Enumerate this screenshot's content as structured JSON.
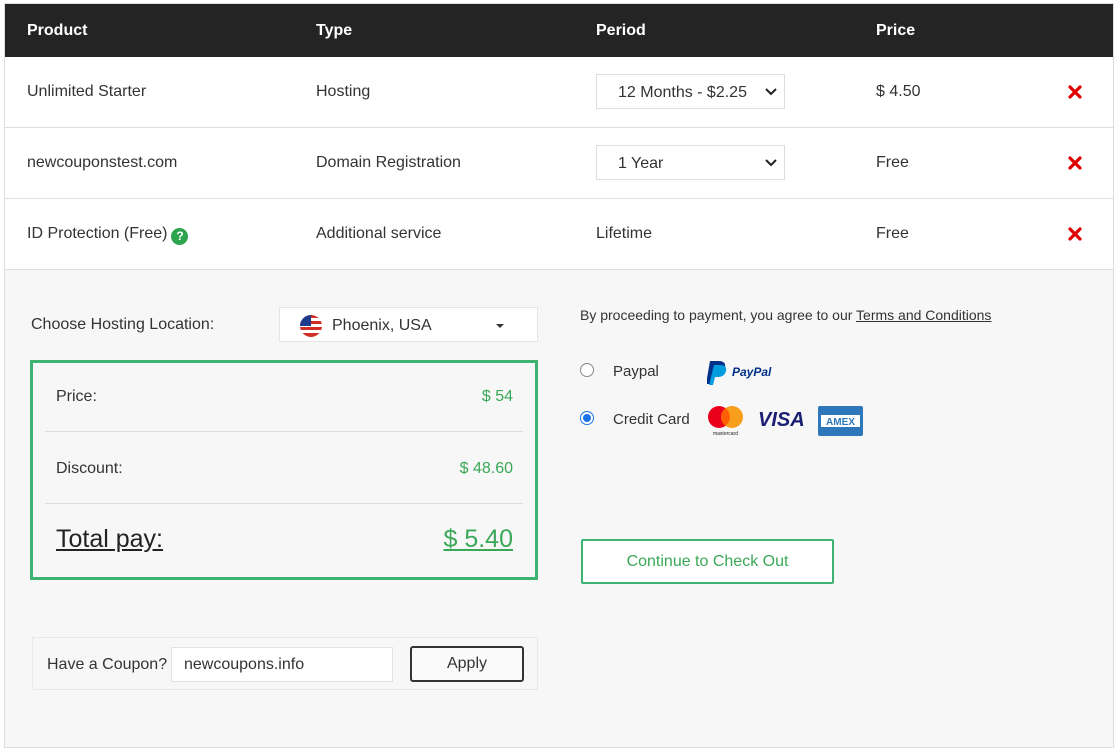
{
  "table": {
    "headers": {
      "product": "Product",
      "type": "Type",
      "period": "Period",
      "price": "Price"
    },
    "rows": [
      {
        "product": "Unlimited Starter",
        "type": "Hosting",
        "period": "12 Months - $2.25",
        "period_is_select": true,
        "price": "$ 4.50"
      },
      {
        "product": "newcouponstest.com",
        "type": "Domain Registration",
        "period": "1 Year",
        "period_is_select": true,
        "price": "Free"
      },
      {
        "product": "ID Protection (Free)",
        "help_icon": "?",
        "type": "Additional service",
        "period": "Lifetime",
        "period_is_select": false,
        "price": "Free"
      }
    ]
  },
  "location": {
    "label": "Choose Hosting Location:",
    "selected": "Phoenix, USA",
    "flag_icon": "us-flag-icon"
  },
  "summary": {
    "price_label": "Price:",
    "price_value": "$ 54",
    "discount_label": "Discount:",
    "discount_value": "$ 48.60",
    "total_label": "Total pay:",
    "total_value": "$ 5.40"
  },
  "coupon": {
    "label": "Have a Coupon?",
    "value": "newcoupons.info",
    "apply_label": "Apply"
  },
  "payment": {
    "terms_prefix": "By proceeding to payment, you agree to our ",
    "terms_link": "Terms and Conditions",
    "methods": [
      {
        "label": "Paypal",
        "selected": false,
        "logos": [
          "paypal-logo"
        ]
      },
      {
        "label": "Credit Card",
        "selected": true,
        "logos": [
          "mastercard-logo",
          "visa-logo",
          "amex-logo"
        ]
      }
    ],
    "logo_text": {
      "paypal": "PayPal",
      "mastercard": "mastercard",
      "visa": "VISA",
      "amex": "AMEX"
    },
    "checkout_label": "Continue to Check Out"
  },
  "colors": {
    "header_bg": "#242424",
    "accent_green": "#3cb371",
    "price_green": "#3aa857",
    "delete_red": "#e00000",
    "radio_blue": "#1a73e8"
  }
}
